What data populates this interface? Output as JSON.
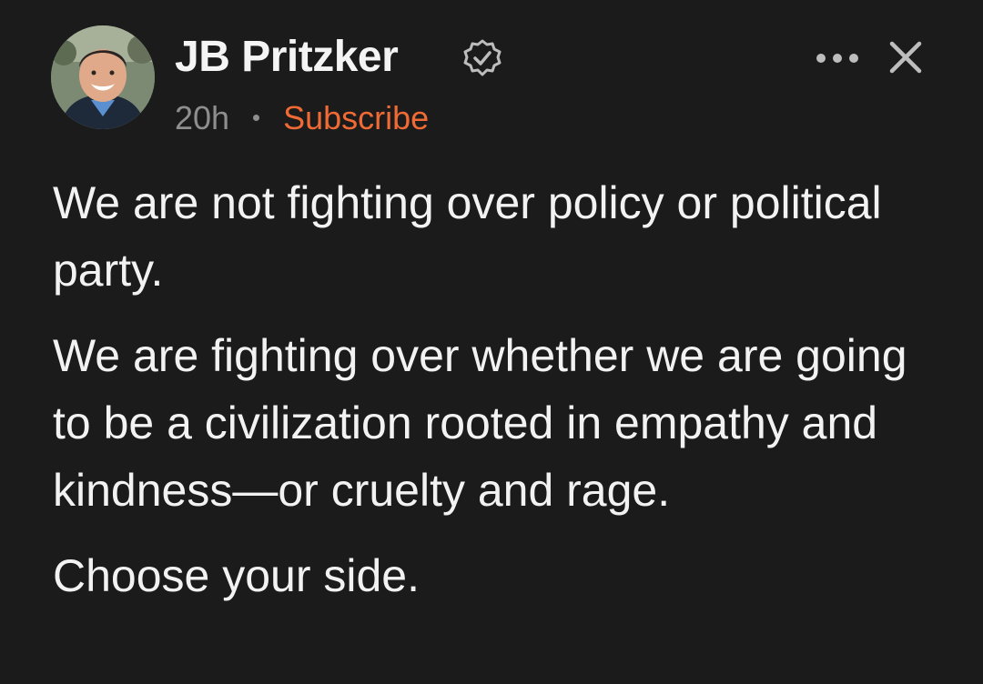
{
  "post": {
    "author": {
      "name": "JB Pritzker",
      "avatar_icon": "profile-photo",
      "verified_icon": "verified-check-icon"
    },
    "meta": {
      "time": "20h",
      "separator_icon": "dot-separator-icon",
      "subscribe_label": "Subscribe"
    },
    "actions": {
      "more_icon": "ellipsis-icon",
      "close_icon": "close-icon"
    },
    "paragraphs": [
      "We are not fighting over policy or political party.",
      "We are fighting over whether we are going to be a civilization rooted in empathy and kindness—or cruelty and rage.",
      "Choose your side."
    ]
  },
  "colors": {
    "background": "#1b1b1b",
    "text": "#f2f2f2",
    "muted": "#8e8e8e",
    "accent": "#ef6a35"
  }
}
